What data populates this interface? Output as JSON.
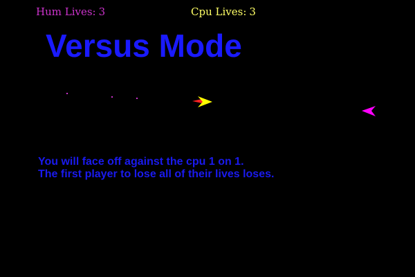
{
  "hud": {
    "human": {
      "label": "Hum Lives:",
      "lives": "3",
      "color": "#cc33cc"
    },
    "cpu": {
      "label": "Cpu Lives:",
      "lives": "3",
      "color": "#ffff66"
    }
  },
  "title": {
    "text": "Versus Mode",
    "color": "#1a1aff"
  },
  "instructions": {
    "color": "#1a1aee",
    "lines": [
      "You will face off against the cpu 1 on 1.",
      "The first player to lose all of their lives loses."
    ]
  },
  "colors": {
    "background": "#000000",
    "player_ship": "#ffff00",
    "player_exhaust": "#ff2222",
    "cpu_ship": "#ff00ff",
    "debris": "#cc33cc"
  },
  "sprites": {
    "player_ship_icon": "arrow-ship-right",
    "cpu_ship_icon": "arrow-ship-left"
  }
}
